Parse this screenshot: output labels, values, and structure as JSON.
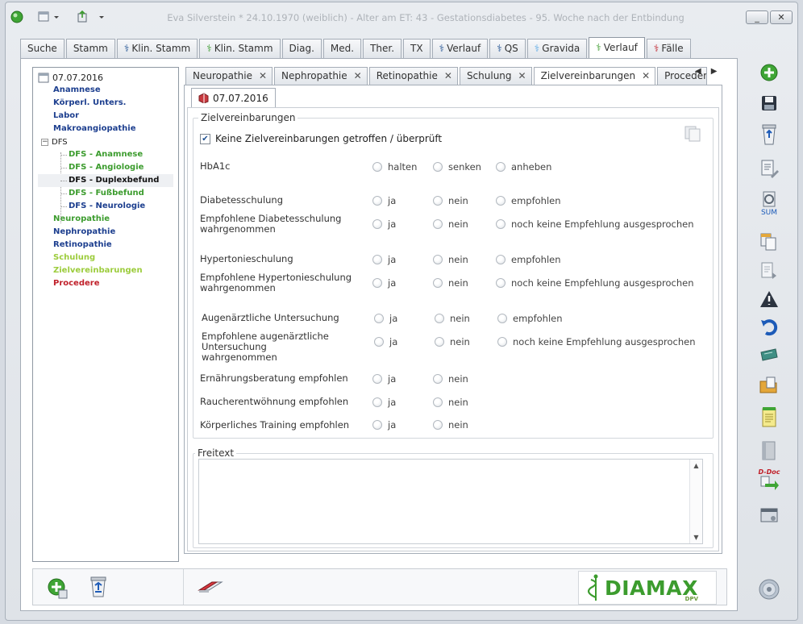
{
  "window": {
    "title": "Eva Silverstein  * 24.10.1970 (weiblich) - Alter am ET: 43 - Gestationsdiabetes - 95. Woche nach der Entbindung",
    "minimize_label": "_",
    "close_label": "✕"
  },
  "main_tabs": [
    {
      "label": "Suche"
    },
    {
      "label": "Stamm"
    },
    {
      "label": "Klin. Stamm",
      "icon": "staff-icon",
      "icon_color": "#1d4f91"
    },
    {
      "label": "Klin. Stamm",
      "icon": "staff-icon",
      "icon_color": "#3c9c2e"
    },
    {
      "label": "Diag."
    },
    {
      "label": "Med."
    },
    {
      "label": "Ther."
    },
    {
      "label": "TX"
    },
    {
      "label": "Verlauf",
      "icon": "staff-icon",
      "icon_color": "#1d4f91"
    },
    {
      "label": "QS",
      "icon": "staff-icon",
      "icon_color": "#1d4f91"
    },
    {
      "label": "Gravida",
      "icon": "staff-icon",
      "icon_color": "#5aa9e6"
    },
    {
      "label": "Verlauf",
      "icon": "staff-icon",
      "icon_color": "#3c9c2e",
      "active": true
    },
    {
      "label": "Fälle",
      "icon": "staff-icon",
      "icon_color": "#c0202a"
    }
  ],
  "tree": {
    "root_label": "07.07.2016",
    "items": [
      {
        "label": "Anamnese",
        "color": "#1d3f8f",
        "level": 1
      },
      {
        "label": "Körperl. Unters.",
        "color": "#1d3f8f",
        "level": 1
      },
      {
        "label": "Labor",
        "color": "#1d3f8f",
        "level": 1
      },
      {
        "label": "Makroangiopathie",
        "color": "#1d3f8f",
        "level": 1
      }
    ],
    "dfs_label": "DFS",
    "dfs_children": [
      {
        "label": "DFS - Anamnese",
        "color": "#3c9c2e"
      },
      {
        "label": "DFS - Angiologie",
        "color": "#3c9c2e"
      },
      {
        "label": "DFS - Duplexbefund",
        "color": "#111111",
        "selected": true
      },
      {
        "label": "DFS - Fußbefund",
        "color": "#3c9c2e"
      },
      {
        "label": "DFS - Neurologie",
        "color": "#1d3f8f"
      }
    ],
    "items_after": [
      {
        "label": "Neuropathie",
        "color": "#3c9c2e"
      },
      {
        "label": "Nephropathie",
        "color": "#1d3f8f"
      },
      {
        "label": "Retinopathie",
        "color": "#1d3f8f"
      },
      {
        "label": "Schulung",
        "color": "#9ccc3c"
      },
      {
        "label": "Zielvereinbarungen",
        "color": "#9ccc3c"
      },
      {
        "label": "Procedere",
        "color": "#c0202a"
      }
    ]
  },
  "sub_tabs": [
    {
      "label": "Neuropathie"
    },
    {
      "label": "Nephropathie"
    },
    {
      "label": "Retinopathie"
    },
    {
      "label": "Schulung"
    },
    {
      "label": "Zielvereinbarungen",
      "active": true
    },
    {
      "label": "Procedere"
    }
  ],
  "sub_tab_close": "✕",
  "sub_tab_prev": "◀",
  "sub_tab_next": "▶",
  "date_tab_label": "07.07.2016",
  "goals": {
    "legend": "Zielvereinbarungen",
    "no_agreement_label": "Keine Zielvereinbarungen getroffen / überprüft",
    "no_agreement_checked": true,
    "check_mark": "✔",
    "questions": [
      {
        "label": "HbA1c",
        "options": [
          "halten",
          "senken",
          "anheben"
        ]
      },
      {
        "label": "Diabetesschulung",
        "options": [
          "ja",
          "nein",
          "empfohlen"
        ]
      },
      {
        "label": "Empfohlene Diabetesschulung wahrgenommen",
        "options": [
          "ja",
          "nein",
          "noch keine Empfehlung ausgesprochen"
        ]
      },
      {
        "label": "Hypertonieschulung",
        "options": [
          "ja",
          "nein",
          "empfohlen"
        ]
      },
      {
        "label": "Empfohlene Hypertonieschulung wahrgenommen",
        "options": [
          "ja",
          "nein",
          "noch keine Empfehlung ausgesprochen"
        ]
      },
      {
        "label": "Augenärztliche Untersuchung",
        "options": [
          "ja",
          "nein",
          "empfohlen"
        ]
      },
      {
        "label": "Empfohlene augenärztliche Untersuchung wahrgenommen",
        "options": [
          "ja",
          "nein",
          "noch keine Empfehlung ausgesprochen"
        ]
      },
      {
        "label": "Ernährungsberatung empfohlen",
        "options": [
          "ja",
          "nein"
        ]
      },
      {
        "label": "Raucherentwöhnung empfohlen",
        "options": [
          "ja",
          "nein"
        ]
      },
      {
        "label": "Körperliches Training empfohlen",
        "options": [
          "ja",
          "nein"
        ]
      }
    ]
  },
  "freitext": {
    "legend": "Freitext",
    "value": "",
    "scroll_up": "▲",
    "scroll_down": "▼"
  },
  "right_toolbar": {
    "sum_label": "SUM",
    "ddoc_label": "D-Doc"
  },
  "brand": {
    "logo_text": "DIAMAX",
    "sub_text": "DPV"
  },
  "colors": {
    "accent_green": "#3c9c2e",
    "accent_blue": "#1d3f8f",
    "accent_red": "#c0202a"
  }
}
